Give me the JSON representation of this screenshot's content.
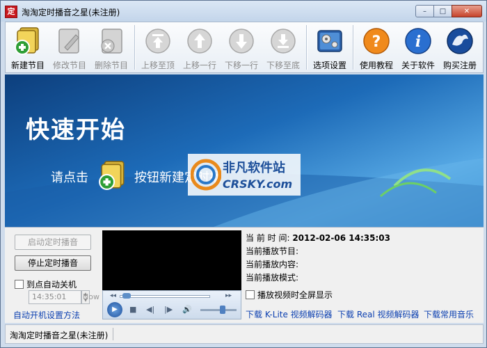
{
  "window": {
    "title": "淘淘定时播音之星(未注册)",
    "app_icon_glyph": "定",
    "controls": {
      "minimize": "–",
      "maximize": "□",
      "close": "✕"
    }
  },
  "toolbar": {
    "items": [
      {
        "label": "新建节目",
        "icon": "new-program-icon",
        "enabled": true
      },
      {
        "label": "修改节目",
        "icon": "edit-program-icon",
        "enabled": false
      },
      {
        "label": "删除节目",
        "icon": "delete-program-icon",
        "enabled": false
      },
      {
        "label": "上移至顶",
        "icon": "move-top-icon",
        "enabled": false
      },
      {
        "label": "上移一行",
        "icon": "move-up-icon",
        "enabled": false
      },
      {
        "label": "下移一行",
        "icon": "move-down-icon",
        "enabled": false
      },
      {
        "label": "下移至底",
        "icon": "move-bottom-icon",
        "enabled": false
      },
      {
        "label": "选项设置",
        "icon": "settings-icon",
        "enabled": true
      },
      {
        "label": "使用教程",
        "icon": "help-icon",
        "enabled": true
      },
      {
        "label": "关于软件",
        "icon": "info-icon",
        "enabled": true
      },
      {
        "label": "购买注册",
        "icon": "register-icon",
        "enabled": true
      }
    ]
  },
  "banner": {
    "title": "快速开始",
    "click_text": "请点击",
    "desc_text": "按钮新建定时播",
    "watermark_cn": "非凡软件站",
    "watermark_en": "CRSKY.com"
  },
  "controls": {
    "start_button": "启动定时播音",
    "stop_button": "停止定时播音",
    "auto_shutdown_label": "到点自动关机",
    "shutdown_time": "14:35:01",
    "now_label": "Now",
    "autostart_link": "自动开机设置方法"
  },
  "info": {
    "current_time_label": "当 前 时 间:",
    "current_time_value": "2012-02-06 14:35:03",
    "current_program_label": "当前播放节目:",
    "current_content_label": "当前播放内容:",
    "current_mode_label": "当前播放模式:",
    "fullscreen_label": "播放视频时全屏显示"
  },
  "links": {
    "klite": "下载 K-Lite 视频解码器",
    "real": "下载 Real 视频解码器",
    "music": "下载常用音乐"
  },
  "status": {
    "text": "淘淘定时播音之星(未注册)"
  }
}
